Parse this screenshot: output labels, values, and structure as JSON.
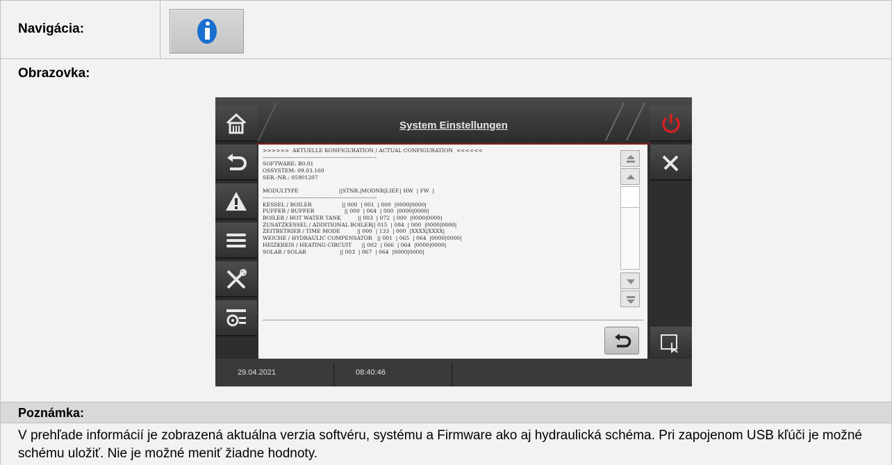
{
  "navigation": {
    "label": "Navigácia:",
    "icon": "info-icon"
  },
  "screen": {
    "label": "Obrazovka:",
    "device": {
      "title": "System Einstellungen",
      "left_buttons": [
        "home-icon",
        "back-icon",
        "warning-icon",
        "menu-icon",
        "tools-icon",
        "settings-icon"
      ],
      "right_buttons": [
        "power-icon",
        "service-icon",
        "touch-icon"
      ],
      "config_lines": [
        ">>>>>>  AKTUELLE KONFIGURATION / ACTUAL CONFIGURATION  <<<<<<",
        "----------------------------------------------------------------",
        "SOFTWARE: B0.01",
        "OSSYSTEM: 09.03.160",
        "SER.-NR.: 05901207",
        "",
        "MODULTYPE                        ||STNR.|MODNR|LIEF.| HW  | FW  |",
        "----------------------------------------------------------------",
        "KESSEL / BOILER                  || 000  | 001  | 000  |0000|0000|",
        "PUFFER / BUFFER                  || 000  | 064  | 000  |0000|0000|",
        "BOILER / HOT WATER TANK          || 003  | 072  | 000  |0000|0000|",
        "ZUSATZKESSEL / ADDITIONAL BOILER|| 015  | 084  | 000  |0000|0000|",
        "ZEITBETRIEB / TIME MODE          || 000  | 133  | 000  |XXXX|XXXX|",
        "WEICHE / HYDRAULIC COMPENSATOR   || 001  | 065  | 064  |0000|0000|",
        "HEIZKREIS / HEATING CIRCUIT      || 002  | 066  | 064  |0000|0000|",
        "SOLAR / SOLAR                    || 003  | 067  | 064  |0000|0000|"
      ],
      "status": {
        "date": "29.04.2021",
        "time": "08:40:46"
      }
    }
  },
  "note": {
    "label": "Poznámka:",
    "text": "V prehľade informácií je zobrazená aktuálna verzia softvéru, systému a Firmware ako aj hydraulická schéma. Pri zapojenom USB kľúči je možné schému uložiť. Nie je možné meniť žiadne hodnoty."
  },
  "colors": {
    "info_blue": "#1a6fd1",
    "power_red": "#d32020",
    "accent_line": "#8a1c1c"
  }
}
